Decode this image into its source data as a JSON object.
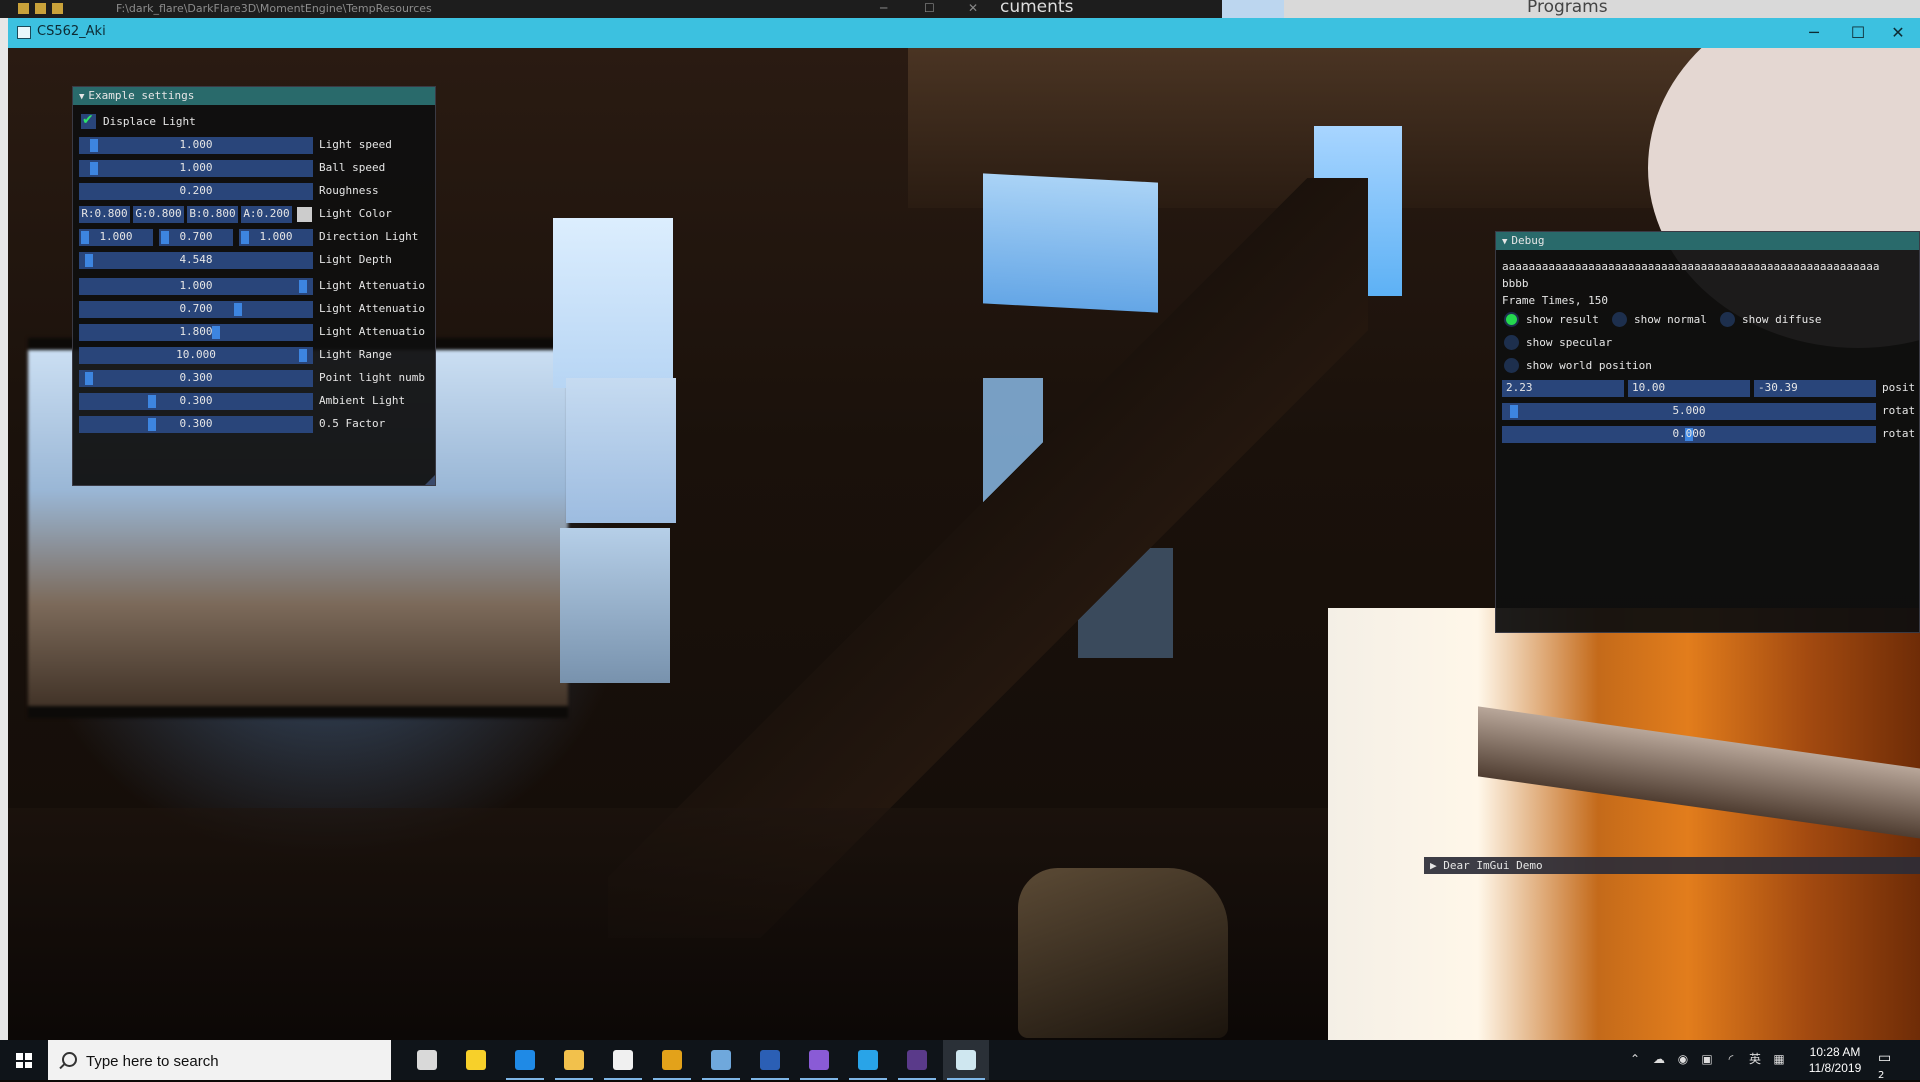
{
  "background": {
    "path": "F:\\dark_flare\\DarkFlare3D\\MomentEngine\\TempResources",
    "documents_label": "cuments",
    "programs_label": "Programs"
  },
  "window": {
    "title": "CS562_Aki",
    "minimize_glyph": "─",
    "maximize_glyph": "☐",
    "close_glyph": "✕"
  },
  "example_settings": {
    "title": "Example settings",
    "displace_light": {
      "label": "Displace Light",
      "checked": true,
      "check_glyph": "✔"
    },
    "sliders": [
      {
        "label": "Light speed",
        "value": "1.000",
        "fraction": 0.04
      },
      {
        "label": "Ball speed",
        "value": "1.000",
        "fraction": 0.04
      },
      {
        "label": "Roughness",
        "value": "0.200",
        "fraction": null
      },
      {
        "label": "Light Depth",
        "value": "4.548",
        "fraction": 0.02
      },
      {
        "label": "Light Attenuatio",
        "value": "1.000",
        "fraction": 0.98
      },
      {
        "label": "Light Attenuatio",
        "value": "0.700",
        "fraction": 0.69
      },
      {
        "label": "Light Attenuatio",
        "value": "1.800",
        "fraction": 0.59
      },
      {
        "label": "Light Range",
        "value": "10.000",
        "fraction": 0.98
      },
      {
        "label": "Point light numb",
        "value": "0.300",
        "fraction": 0.02
      },
      {
        "label": "Ambient Light",
        "value": "0.300",
        "fraction": 0.3
      },
      {
        "label": "0.5 Factor",
        "value": "0.300",
        "fraction": 0.3
      }
    ],
    "light_color": {
      "label": "Light Color",
      "r": "R:0.800",
      "g": "G:0.800",
      "b": "B:0.800",
      "a": "A:0.200",
      "swatch_color": "#cccccc"
    },
    "direction_light": {
      "label": "Direction Light",
      "x": "1.000",
      "y": "0.700",
      "z": "1.000"
    }
  },
  "debug": {
    "title": "Debug",
    "line1": "aaaaaaaaaaaaaaaaaaaaaaaaaaaaaaaaaaaaaaaaaaaaaaaaaaaaaaaaa",
    "line2": "bbbb",
    "frame_times": "Frame Times,  150",
    "radios": [
      {
        "label": "show result",
        "selected": true
      },
      {
        "label": "show normal",
        "selected": false
      },
      {
        "label": "show diffuse",
        "selected": false
      },
      {
        "label": "show specular",
        "selected": false
      },
      {
        "label": "show world position",
        "selected": false
      }
    ],
    "position": {
      "x": "2.23",
      "y": "10.00",
      "z": "-30.39",
      "label": "posit"
    },
    "rotate1": {
      "value": "5.000",
      "label": "rotat"
    },
    "rotate2": {
      "value": "0.000",
      "label": "rotat"
    }
  },
  "dear_imgui_demo": {
    "label": "Dear ImGui Demo"
  },
  "taskbar": {
    "search_placeholder": "Type here to search",
    "apps": [
      {
        "name": "task-view",
        "color": "#d9d9d9"
      },
      {
        "name": "sticky-notes",
        "color": "#f7d02a"
      },
      {
        "name": "edge",
        "color": "#1f8ae6"
      },
      {
        "name": "file-explorer",
        "color": "#f2c14c"
      },
      {
        "name": "mail",
        "color": "#f0f0f0"
      },
      {
        "name": "chrome",
        "color": "#e3a21a"
      },
      {
        "name": "steam",
        "color": "#6fa8dc"
      },
      {
        "name": "word",
        "color": "#2b5fb5"
      },
      {
        "name": "visual-studio",
        "color": "#8a5bd6"
      },
      {
        "name": "vscode",
        "color": "#29a4e8"
      },
      {
        "name": "terminal-app",
        "color": "#5a3a8a"
      },
      {
        "name": "cs562-app",
        "color": "#cfe7f0"
      }
    ],
    "ime": "英",
    "time": "10:28 AM",
    "date": "11/8/2019",
    "notification_count": "2"
  }
}
